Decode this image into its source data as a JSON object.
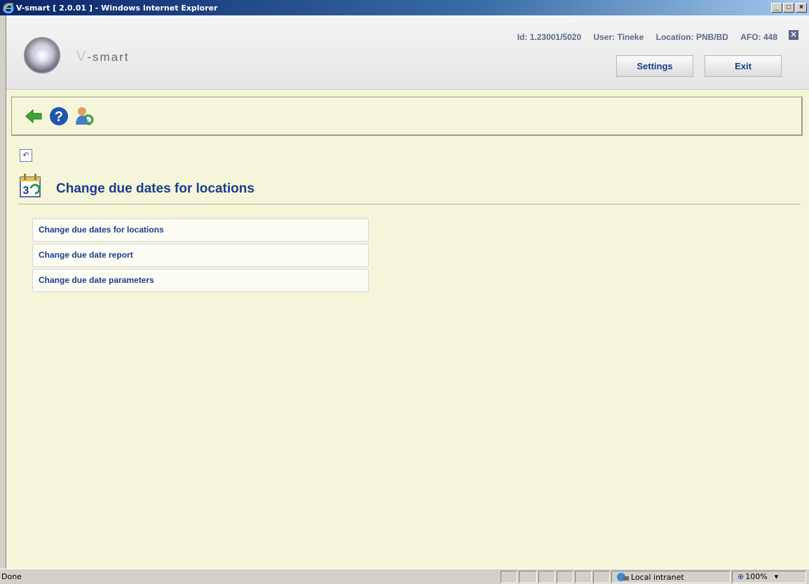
{
  "window": {
    "title": "V-smart [ 2.0.01 ] - Windows Internet Explorer"
  },
  "header": {
    "brand": "-smart",
    "brand_v": "V",
    "id": "Id: 1.23001/5020",
    "user": "User: Tineke",
    "location": "Location: PNB/BD",
    "afo": "AFO: 448",
    "settings_label": "Settings",
    "exit_label": "Exit"
  },
  "toolbar": {
    "icons": [
      "back-arrow-icon",
      "help-icon",
      "user-refresh-icon"
    ]
  },
  "page": {
    "title": "Change due dates for locations"
  },
  "menu": {
    "items": [
      {
        "label": "Change due dates for locations"
      },
      {
        "label": "Change due date report"
      },
      {
        "label": "Change due date parameters"
      }
    ]
  },
  "statusbar": {
    "status": "Done",
    "zone": "Local intranet",
    "zoom": "100%"
  },
  "colors": {
    "accent": "#1c3d8f",
    "background": "#f5f5d9"
  }
}
